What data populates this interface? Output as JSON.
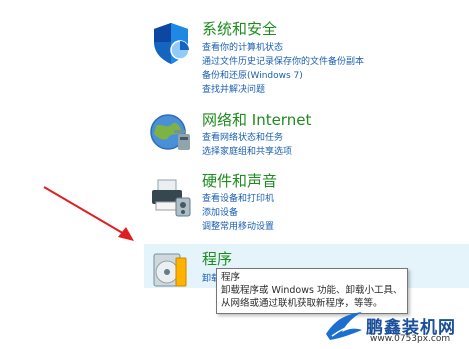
{
  "categories": {
    "system": {
      "title": "系统和安全",
      "icon": "shield-icon",
      "links": [
        "查看你的计算机状态",
        "通过文件历史记录保存你的文件备份副本",
        "备份和还原(Windows 7)",
        "查找并解决问题"
      ]
    },
    "network": {
      "title": "网络和 Internet",
      "icon": "globe-network-icon",
      "links": [
        "查看网络状态和任务",
        "选择家庭组和共享选项"
      ]
    },
    "hardware": {
      "title": "硬件和声音",
      "icon": "printer-icon",
      "links": [
        "查看设备和打印机",
        "添加设备",
        "调整常用移动设置"
      ]
    },
    "programs": {
      "title": "程序",
      "icon": "program-disc-icon",
      "link_partial": "卸载"
    }
  },
  "tooltip": {
    "title": "程序",
    "body": "卸载程序或 Windows 功能、卸载小工具、从网络或通过联机获取新程序，等等。"
  },
  "watermark": {
    "title": "鹏鑫装机网",
    "url": "www.0753px.com"
  },
  "colors": {
    "title_green": "#1e8c1e",
    "link_blue": "#1a5fb4",
    "hover_bg": "#e5f3fb",
    "arrow_red": "#e02020"
  }
}
